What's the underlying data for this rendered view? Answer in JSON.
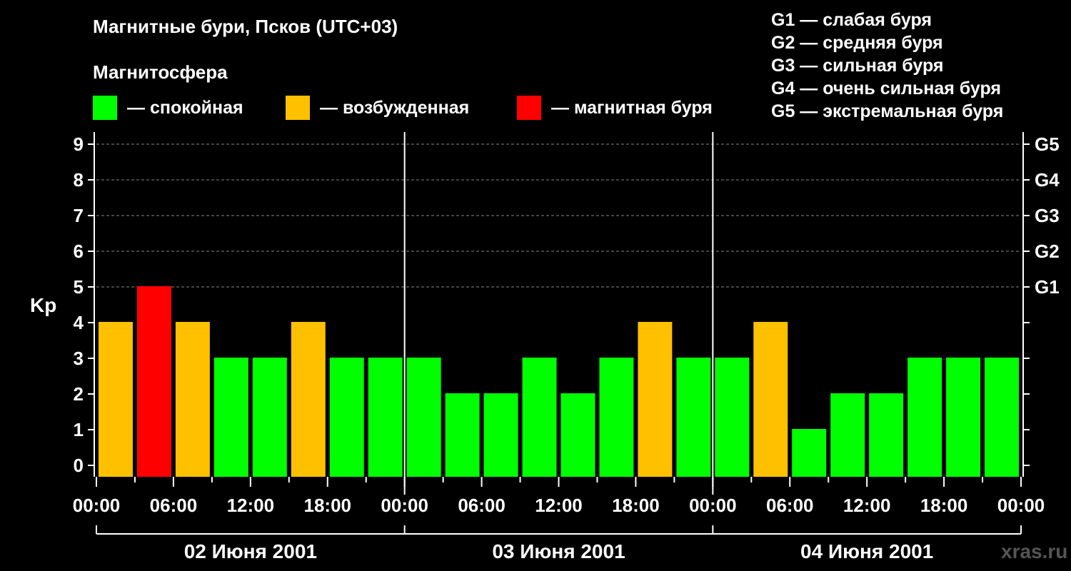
{
  "title": "Магнитные бури, Псков (UTC+03)",
  "subtitle": "Магнитосфера",
  "legend": [
    {
      "label": "— спокойная",
      "color": "#00ff00"
    },
    {
      "label": "— возбужденная",
      "color": "#ffc000"
    },
    {
      "label": "— магнитная буря",
      "color": "#ff0000"
    }
  ],
  "g_legend": [
    "G1 — слабая буря",
    "G2 — средняя буря",
    "G3 — сильная буря",
    "G4 — очень сильная буря",
    "G5 — экстремальная буря"
  ],
  "watermark": "xras.ru",
  "chart_data": {
    "type": "bar",
    "ylabel": "Kp",
    "ylim": [
      0,
      9
    ],
    "y_ticks": [
      "0",
      "1",
      "2",
      "3",
      "4",
      "5",
      "6",
      "7",
      "8",
      "9"
    ],
    "right_ticks": [
      {
        "value": 5,
        "label": "G1"
      },
      {
        "value": 6,
        "label": "G2"
      },
      {
        "value": 7,
        "label": "G3"
      },
      {
        "value": 8,
        "label": "G4"
      },
      {
        "value": 9,
        "label": "G5"
      }
    ],
    "x_tick_labels": [
      "00:00",
      "06:00",
      "12:00",
      "18:00",
      "00:00",
      "06:00",
      "12:00",
      "18:00",
      "00:00",
      "06:00",
      "12:00",
      "18:00",
      "00:00"
    ],
    "days": [
      "02 Июня 2001",
      "03 Июня 2001",
      "04 Июня 2001"
    ],
    "values": [
      4,
      5,
      4,
      3,
      3,
      4,
      3,
      3,
      3,
      2,
      2,
      3,
      2,
      3,
      4,
      3,
      3,
      4,
      1,
      2,
      2,
      3,
      3,
      3
    ],
    "colors": {
      "quiet": "#00ff00",
      "active": "#ffc000",
      "storm": "#ff0000"
    },
    "grid": "dashed at 5-9"
  }
}
